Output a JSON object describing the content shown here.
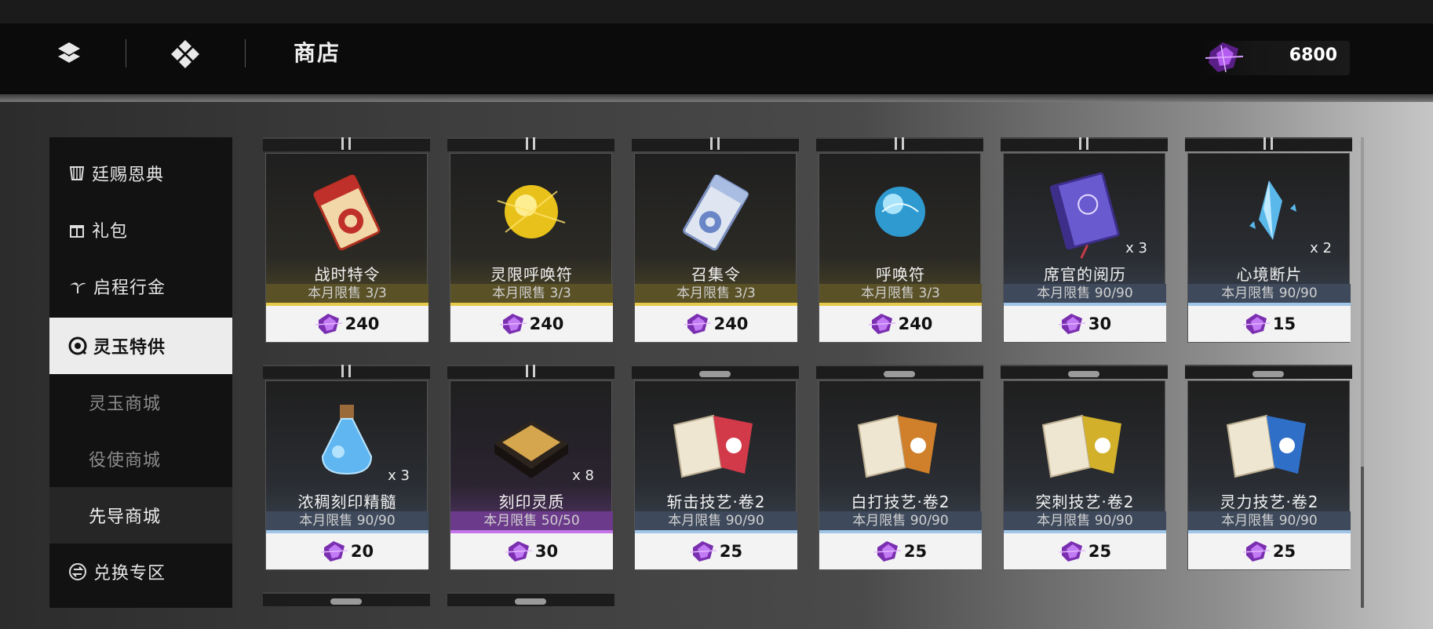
{
  "header": {
    "title": "商店",
    "currency_amount": "6800",
    "nav_icons": [
      "layers-icon",
      "diamond-grid-icon"
    ],
    "currency_icon": "purple-crystal-icon"
  },
  "background": {
    "watermark": ""
  },
  "sidebar": {
    "items": [
      {
        "label": "廷赐恩典",
        "icon": "scroll-icon",
        "state": "normal"
      },
      {
        "label": "礼包",
        "icon": "gift-icon",
        "state": "normal"
      },
      {
        "label": "启程行金",
        "icon": "sprout-icon",
        "state": "normal"
      },
      {
        "label": "灵玉特供",
        "icon": "jade-icon",
        "state": "active"
      },
      {
        "label": "灵玉商城",
        "icon": "",
        "state": "sub"
      },
      {
        "label": "役使商城",
        "icon": "",
        "state": "sub"
      },
      {
        "label": "先导商城",
        "icon": "",
        "state": "sub-selected"
      },
      {
        "label": "兑换专区",
        "icon": "exchange-icon",
        "state": "normal"
      }
    ]
  },
  "shop": {
    "items": [
      {
        "name": "战时特令",
        "limit": "本月限售 3/3",
        "price": "240",
        "qty": "",
        "rarity": "gold",
        "icon": "red-ticket-icon"
      },
      {
        "name": "灵限呼唤符",
        "limit": "本月限售 3/3",
        "price": "240",
        "qty": "",
        "rarity": "gold",
        "icon": "golden-orb-icon"
      },
      {
        "name": "召集令",
        "limit": "本月限售 3/3",
        "price": "240",
        "qty": "",
        "rarity": "gold",
        "icon": "silver-ticket-icon"
      },
      {
        "name": "呼唤符",
        "limit": "本月限售 3/3",
        "price": "240",
        "qty": "",
        "rarity": "gold",
        "icon": "blue-orb-icon"
      },
      {
        "name": "席官的阅历",
        "limit": "本月限售 90/90",
        "price": "30",
        "qty": "x 3",
        "rarity": "blue",
        "icon": "purple-book-icon"
      },
      {
        "name": "心境断片",
        "limit": "本月限售 90/90",
        "price": "15",
        "qty": "x 2",
        "rarity": "blue",
        "icon": "crystal-shard-icon"
      },
      {
        "name": "浓稠刻印精髓",
        "limit": "本月限售 90/90",
        "price": "20",
        "qty": "x 3",
        "rarity": "blue",
        "icon": "potion-flask-icon"
      },
      {
        "name": "刻印灵质",
        "limit": "本月限售 50/50",
        "price": "30",
        "qty": "x 8",
        "rarity": "purple",
        "icon": "earth-cushion-icon"
      },
      {
        "name": "斩击技艺·卷2",
        "limit": "本月限售 90/90",
        "price": "25",
        "qty": "",
        "rarity": "blue",
        "icon": "red-scroll-icon"
      },
      {
        "name": "白打技艺·卷2",
        "limit": "本月限售 90/90",
        "price": "25",
        "qty": "",
        "rarity": "blue",
        "icon": "orange-scroll-icon"
      },
      {
        "name": "突刺技艺·卷2",
        "limit": "本月限售 90/90",
        "price": "25",
        "qty": "",
        "rarity": "blue",
        "icon": "yellow-scroll-icon"
      },
      {
        "name": "灵力技艺·卷2",
        "limit": "本月限售 90/90",
        "price": "25",
        "qty": "",
        "rarity": "blue",
        "icon": "blue-scroll-icon"
      }
    ]
  },
  "colors": {
    "accent_gold": "#e6c94a",
    "accent_blue": "#9fc6e8",
    "accent_purple": "#c476e8",
    "currency": "#a64ae0"
  }
}
